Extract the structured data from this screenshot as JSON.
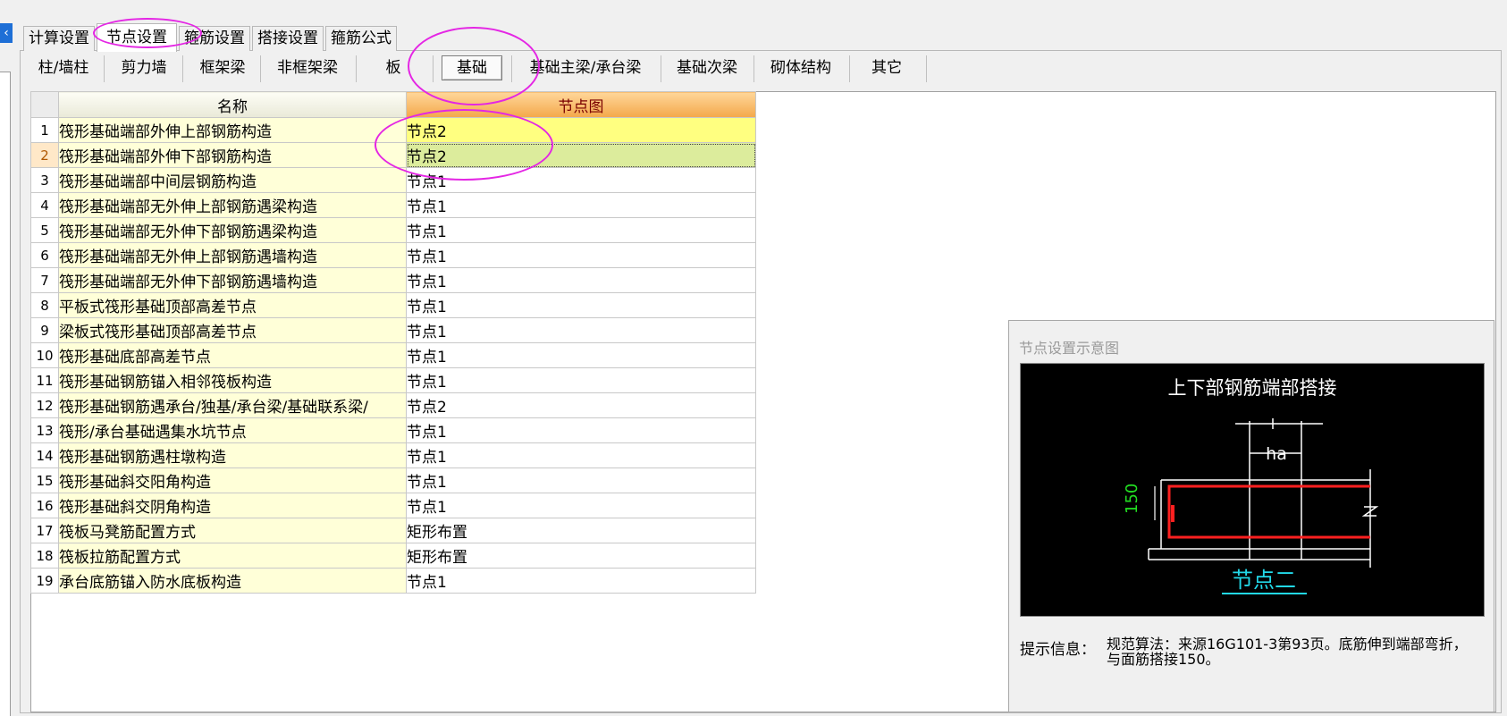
{
  "top_tabs": [
    "计算设置",
    "节点设置",
    "箍筋设置",
    "搭接设置",
    "箍筋公式"
  ],
  "active_top_tab": "节点设置",
  "sub_tabs": [
    "柱/墙柱",
    "剪力墙",
    "框架梁",
    "非框架梁",
    "板",
    "基础",
    "基础主梁/承台梁",
    "基础次梁",
    "砌体结构",
    "其它"
  ],
  "active_sub_tab": "基础",
  "grid": {
    "headers": {
      "name": "名称",
      "node": "节点图"
    },
    "rows": [
      {
        "idx": "1",
        "name": "筏形基础端部外伸上部钢筋构造",
        "node": "节点2"
      },
      {
        "idx": "2",
        "name": "筏形基础端部外伸下部钢筋构造",
        "node": "节点2"
      },
      {
        "idx": "3",
        "name": "筏形基础端部中间层钢筋构造",
        "node": "节点1"
      },
      {
        "idx": "4",
        "name": "筏形基础端部无外伸上部钢筋遇梁构造",
        "node": "节点1"
      },
      {
        "idx": "5",
        "name": "筏形基础端部无外伸下部钢筋遇梁构造",
        "node": "节点1"
      },
      {
        "idx": "6",
        "name": "筏形基础端部无外伸上部钢筋遇墙构造",
        "node": "节点1"
      },
      {
        "idx": "7",
        "name": "筏形基础端部无外伸下部钢筋遇墙构造",
        "node": "节点1"
      },
      {
        "idx": "8",
        "name": "平板式筏形基础顶部高差节点",
        "node": "节点1"
      },
      {
        "idx": "9",
        "name": "梁板式筏形基础顶部高差节点",
        "node": "节点1"
      },
      {
        "idx": "10",
        "name": "筏形基础底部高差节点",
        "node": "节点1"
      },
      {
        "idx": "11",
        "name": "筏形基础钢筋锚入相邻筏板构造",
        "node": "节点1"
      },
      {
        "idx": "12",
        "name": "筏形基础钢筋遇承台/独基/承台梁/基础联系梁/",
        "node": "节点2"
      },
      {
        "idx": "13",
        "name": "筏形/承台基础遇集水坑节点",
        "node": "节点1"
      },
      {
        "idx": "14",
        "name": "筏形基础钢筋遇柱墩构造",
        "node": "节点1"
      },
      {
        "idx": "15",
        "name": "筏形基础斜交阳角构造",
        "node": "节点1"
      },
      {
        "idx": "16",
        "name": "筏形基础斜交阴角构造",
        "node": "节点1"
      },
      {
        "idx": "17",
        "name": "筏板马凳筋配置方式",
        "node": "矩形布置"
      },
      {
        "idx": "18",
        "name": "筏板拉筋配置方式",
        "node": "矩形布置"
      },
      {
        "idx": "19",
        "name": "承台底筋锚入防水底板构造",
        "node": "节点1"
      }
    ]
  },
  "preview": {
    "title": "节点设置示意图",
    "diagram_title": "上下部钢筋端部搭接",
    "dim_ha": "ha",
    "dim_150": "150",
    "node_caption": "节点二",
    "hint_label": "提示信息：",
    "hint_text": "规范算法：来源16G101-3第93页。底筋伸到端部弯折，与面筋搭接150。"
  },
  "colors": {
    "annotation": "#e426e4",
    "header_node": "#f3a84a",
    "name_cell_bg": "#ffffd8",
    "row1_node_bg": "#ffff80",
    "row2_node_bg": "#dcec9c",
    "rebar_red": "#ff2020",
    "caption_cyan": "#22d8e8",
    "dim_green": "#22e022"
  },
  "icons": {
    "collapse": "chevron-left-icon"
  }
}
